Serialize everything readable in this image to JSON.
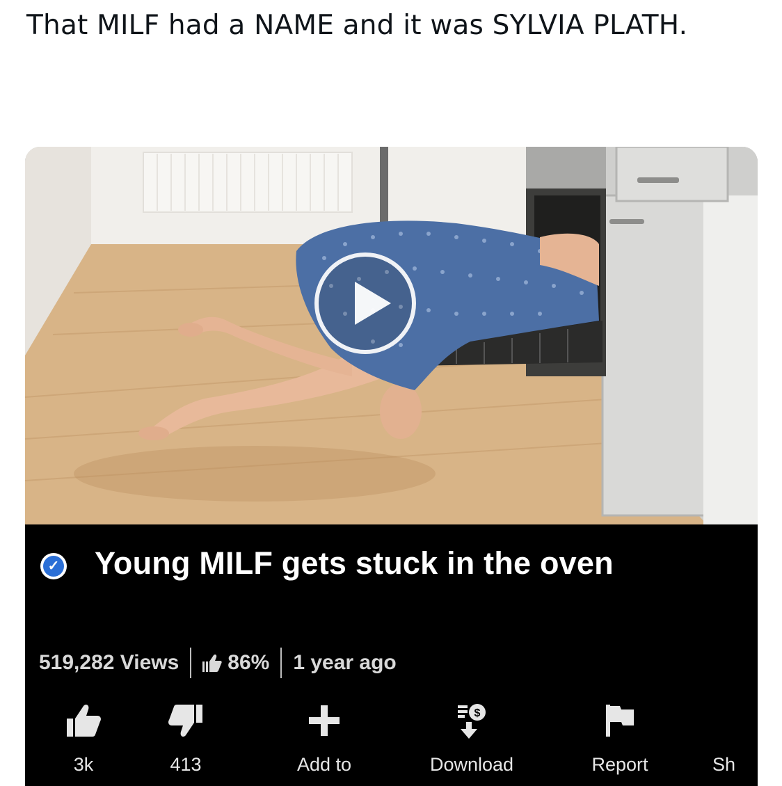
{
  "tweet": {
    "text": "That MILF had a NAME and it was SYLVIA PLATH."
  },
  "video": {
    "title": "Young MILF gets stuck in the oven",
    "verified_icon": "checkmark-verified-icon",
    "views": "519,282 Views",
    "rating": "86%",
    "age": "1 year ago",
    "play_icon": "play-icon"
  },
  "actions": {
    "like": {
      "label": "3k",
      "icon": "thumbs-up-icon"
    },
    "dislike": {
      "label": "413",
      "icon": "thumbs-down-icon"
    },
    "add": {
      "label": "Add to",
      "icon": "plus-icon"
    },
    "download": {
      "label": "Download",
      "icon": "download-money-icon"
    },
    "report": {
      "label": "Report",
      "icon": "flag-icon"
    },
    "share": {
      "label": "Sh",
      "icon": "share-icon"
    }
  },
  "colors": {
    "background": "#ffffff",
    "panel": "#000000",
    "verified_blue": "#2b6fd6",
    "tweet_text": "#0f1419"
  }
}
